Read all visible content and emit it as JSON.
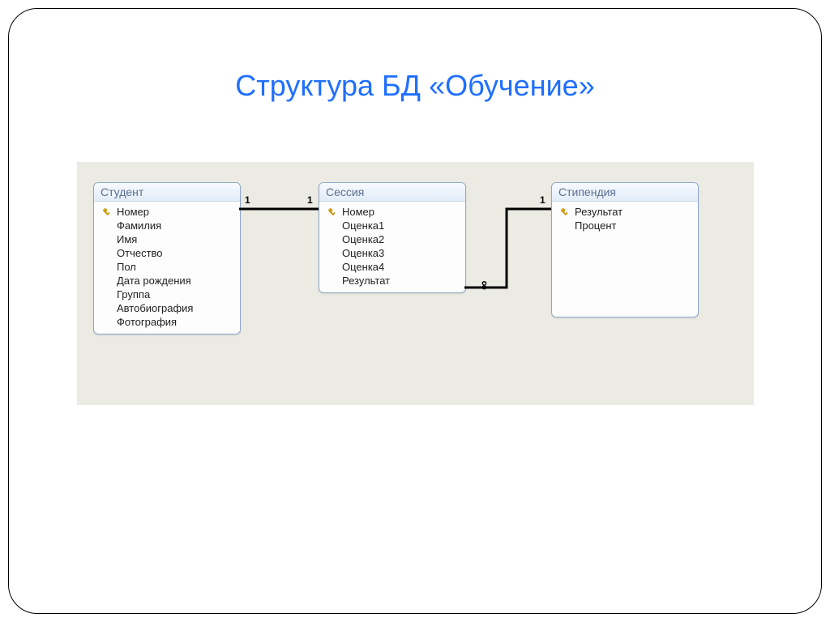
{
  "title": "Структура БД «Обучение»",
  "entities": {
    "student": {
      "title": "Студент",
      "fields": [
        {
          "name": "Номер",
          "pk": true
        },
        {
          "name": "Фамилия",
          "pk": false
        },
        {
          "name": "Имя",
          "pk": false
        },
        {
          "name": "Отчество",
          "pk": false
        },
        {
          "name": "Пол",
          "pk": false
        },
        {
          "name": "Дата рождения",
          "pk": false
        },
        {
          "name": "Группа",
          "pk": false
        },
        {
          "name": "Автобиография",
          "pk": false
        },
        {
          "name": "Фотография",
          "pk": false
        }
      ]
    },
    "session": {
      "title": "Сессия",
      "fields": [
        {
          "name": "Номер",
          "pk": true
        },
        {
          "name": "Оценка1",
          "pk": false
        },
        {
          "name": "Оценка2",
          "pk": false
        },
        {
          "name": "Оценка3",
          "pk": false
        },
        {
          "name": "Оценка4",
          "pk": false
        },
        {
          "name": "Результат",
          "pk": false
        }
      ]
    },
    "stipend": {
      "title": "Стипендия",
      "fields": [
        {
          "name": "Результат",
          "pk": true
        },
        {
          "name": "Процент",
          "pk": false
        }
      ]
    }
  },
  "relations": {
    "r1": {
      "left_label": "1",
      "right_label": "1"
    },
    "r2": {
      "left_label": "∞",
      "right_label": "1"
    }
  }
}
